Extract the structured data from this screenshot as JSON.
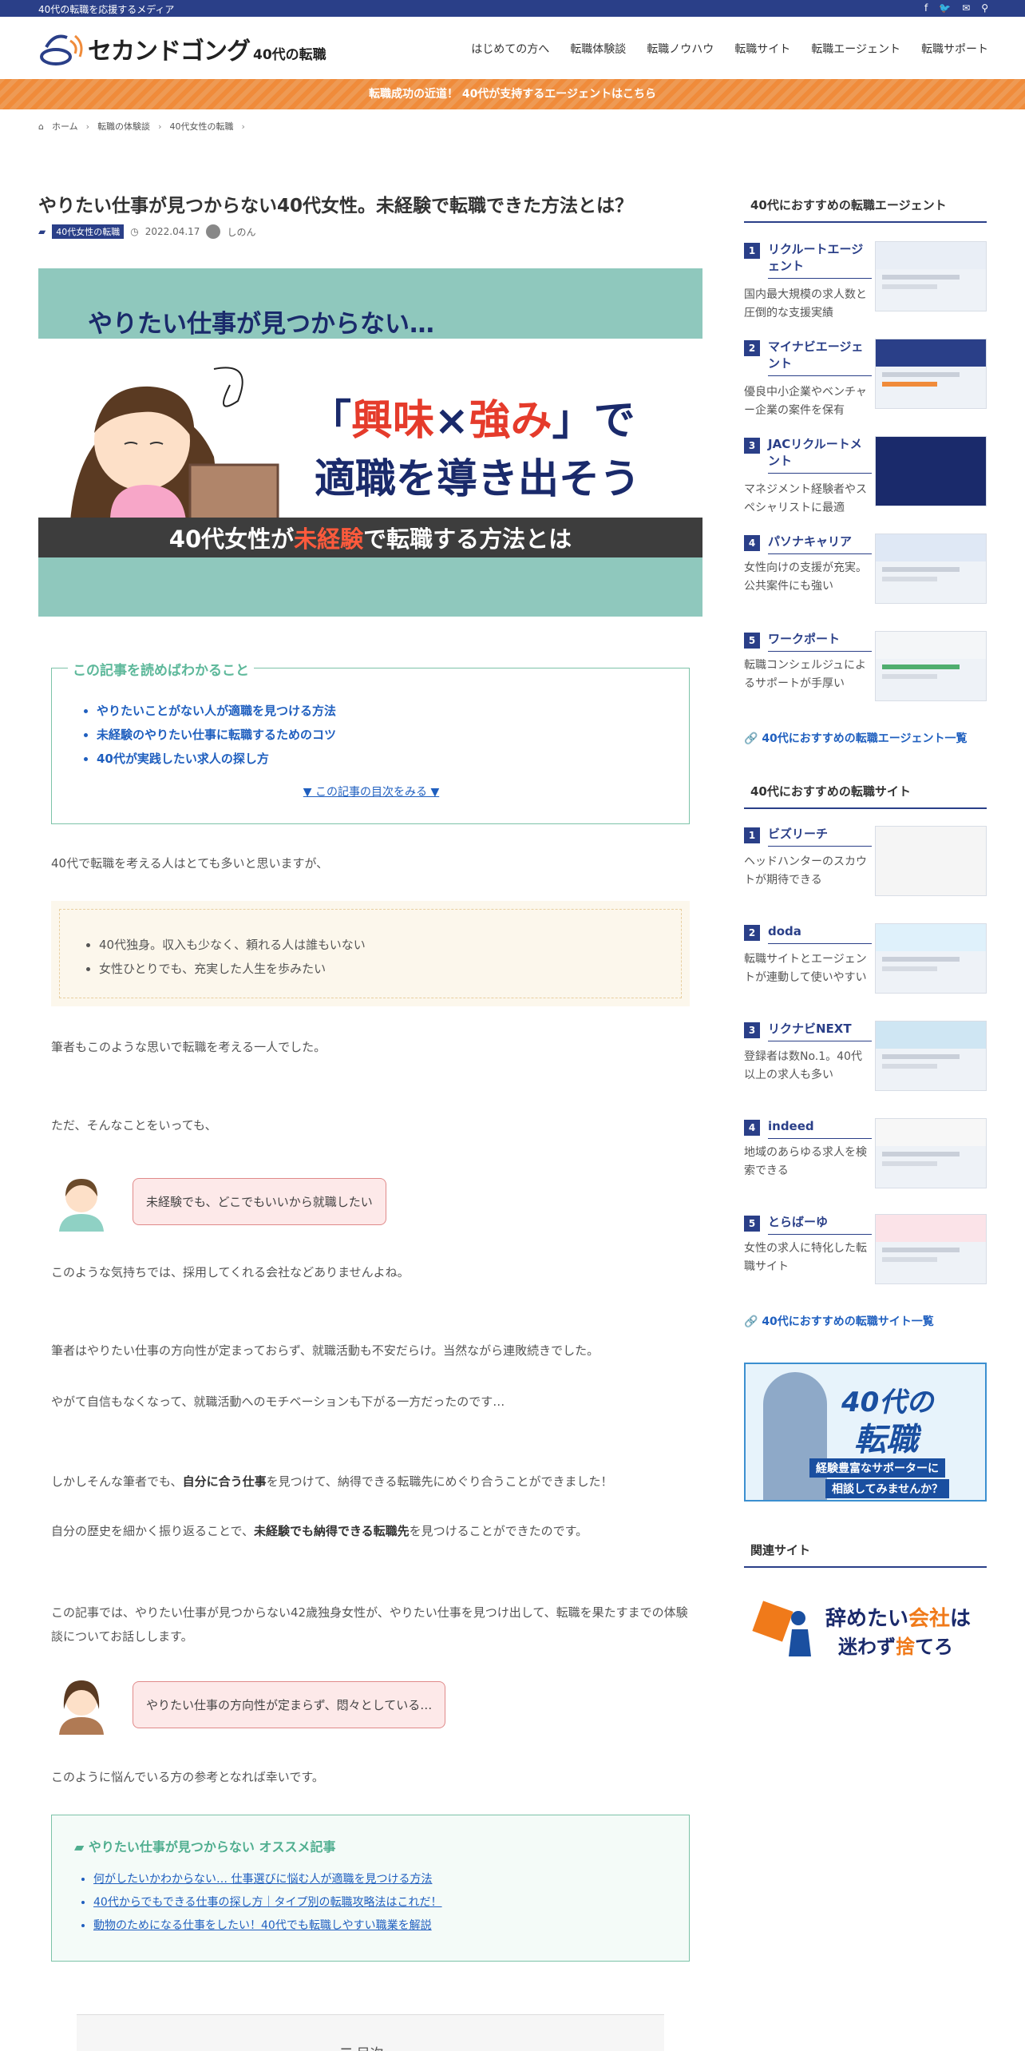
{
  "topbar": {
    "tagline": "40代の転職を応援するメディア",
    "icons": [
      "facebook-icon",
      "twitter-icon",
      "mail-icon",
      "search-icon"
    ]
  },
  "header": {
    "logo_name": "セカンドゴング",
    "logo_sub": "40代の転職",
    "nav": [
      "はじめての方へ",
      "転職体験談",
      "転職ノウハウ",
      "転職サイト",
      "転職エージェント",
      "転職サポート"
    ]
  },
  "banner": {
    "text": "転職成功の近道！ 40代が支持するエージェントはこちら"
  },
  "breadcrumb": [
    "ホーム",
    "転職の体験談",
    "40代女性の転職"
  ],
  "article": {
    "title": "やりたい仕事が見つからない40代女性。未経験で転職できた方法とは？",
    "category": "40代女性の転職",
    "date": "2022.04.17",
    "author": "しのん",
    "eyecatch": {
      "line1": "やりたい仕事が見つからない…",
      "line2_pre": "「",
      "line2_a": "興味",
      "line2_x": "×",
      "line2_b": "強み",
      "line2_post": "」で",
      "line3": "適職を導き出そう",
      "line4_a": "40代女性が",
      "line4_b": "未経験",
      "line4_c": "で転職する方法とは"
    },
    "toc": {
      "legend": "この記事を読めばわかること",
      "items": [
        "やりたいことがない人が適職を見つける方法",
        "未経験のやりたい仕事に転職するためのコツ",
        "40代が実践したい求人の探し方"
      ],
      "more": "▼ この記事の目次をみる ▼"
    },
    "p1": "40代で転職を考える人はとても多いと思いますが、",
    "dotlist": [
      "40代独身。収入も少なく、頼れる人は誰もいない",
      "女性ひとりでも、充実した人生を歩みたい"
    ],
    "p2": "筆者もこのような思いで転職を考える一人でした。",
    "p3": "ただ、そんなことをいっても、",
    "bubble1": "未経験でも、どこでもいいから就職したい",
    "p4": "このような気持ちでは、採用してくれる会社などありませんよね。",
    "p5": "筆者はやりたい仕事の方向性が定まっておらず、就職活動も不安だらけ。当然ながら連敗続きでした。",
    "p6": "やがて自信もなくなって、就職活動へのモチベーションも下がる一方だったのです…",
    "p7_a": "しかしそんな筆者でも、",
    "p7_b": "自分に合う仕事",
    "p7_c": "を見つけて、納得できる転職先にめぐり合うことができました！",
    "p8_a": "自分の歴史を細かく振り返ることで、",
    "p8_b": "未経験でも納得できる転職先",
    "p8_c": "を見つけることができたのです。",
    "p9": "この記事では、やりたい仕事が見つからない42歳独身女性が、やりたい仕事を見つけ出して、転職を果たすまでの体験談についてお話しします。",
    "bubble2": "やりたい仕事の方向性が定まらず、悶々としている…",
    "p10": "このように悩んでいる方の参考となれば幸いです。",
    "recommend": {
      "head": "やりたい仕事が見つからない オススメ記事",
      "items": [
        "何がしたいかわからない… 仕事選びに悩む人が適職を見つける方法",
        "40代からでもできる仕事の探し方｜タイプ別の転職攻略法はこれだ！",
        "動物のためになる仕事をしたい！40代でも転職しやすい職業を解説"
      ]
    },
    "toc2_title": "目次"
  },
  "sidebar": {
    "agents": {
      "heading": "40代におすすめの転職エージェント",
      "items": [
        {
          "num": "1",
          "name": "リクルートエージェント",
          "desc": "国内最大規模の求人数と圧倒的な支援実績"
        },
        {
          "num": "2",
          "name": "マイナビエージェント",
          "desc": "優良中小企業やベンチャー企業の案件を保有"
        },
        {
          "num": "3",
          "name": "JACリクルートメント",
          "desc": "マネジメント経験者やスペシャリストに最適"
        },
        {
          "num": "4",
          "name": "パソナキャリア",
          "desc": "女性向けの支援が充実。公共案件にも強い"
        },
        {
          "num": "5",
          "name": "ワークポート",
          "desc": "転職コンシェルジュによるサポートが手厚い"
        }
      ],
      "link": "40代におすすめの転職エージェント一覧"
    },
    "sites": {
      "heading": "40代におすすめの転職サイト",
      "items": [
        {
          "num": "1",
          "name": "ビズリーチ",
          "desc": "ヘッドハンターのスカウトが期待できる"
        },
        {
          "num": "2",
          "name": "doda",
          "desc": "転職サイトとエージェントが連動して使いやすい"
        },
        {
          "num": "3",
          "name": "リクナビNEXT",
          "desc": "登録者は数No.1。40代以上の求人も多い"
        },
        {
          "num": "4",
          "name": "indeed",
          "desc": "地域のあらゆる求人を検索できる"
        },
        {
          "num": "5",
          "name": "とらばーゆ",
          "desc": "女性の求人に特化した転職サイト"
        }
      ],
      "link": "40代におすすめの転職サイト一覧"
    },
    "promo": {
      "big1": "40代の",
      "big2": "転職",
      "cap1": "経験豊富なサポーターに",
      "cap2": "相談してみませんか？"
    },
    "related_heading": "関連サイト",
    "quit": {
      "a": "辞めたい",
      "b": "会社",
      "c": "は",
      "d": "迷わず",
      "e": "捨",
      "f": "てろ"
    }
  },
  "colors": {
    "navy": "#2a3f88",
    "orange": "#f08b3a",
    "teal": "#8fc8bd",
    "green": "#5db89a",
    "link": "#1f5fbf"
  }
}
